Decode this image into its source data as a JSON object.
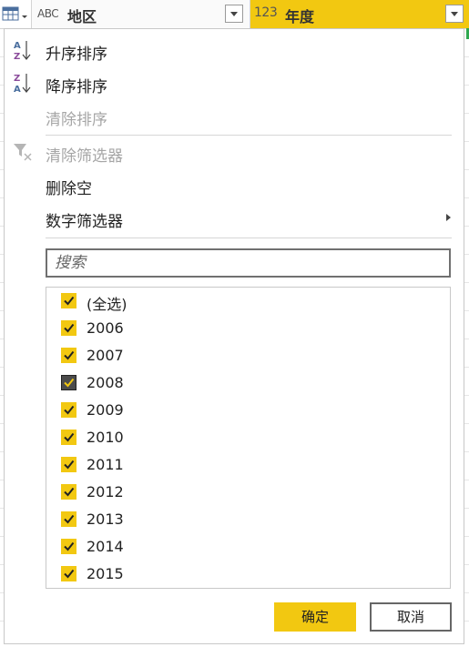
{
  "header": {
    "table_icon": "table-icon",
    "columns": [
      {
        "type_label": "ABC",
        "name": "地区",
        "active": false
      },
      {
        "type_label": "123",
        "name": "年度",
        "active": true
      }
    ]
  },
  "menu": {
    "sort_asc": "升序排序",
    "sort_desc": "降序排序",
    "clear_sort": "清除排序",
    "clear_filter": "清除筛选器",
    "remove_empty": "删除空",
    "number_filters": "数字筛选器"
  },
  "search": {
    "placeholder": "搜索",
    "value": ""
  },
  "list": {
    "items": [
      {
        "label": "(全选)",
        "checked": true
      },
      {
        "label": "2006",
        "checked": true
      },
      {
        "label": "2007",
        "checked": true
      },
      {
        "label": "2008",
        "checked": true,
        "focused": true
      },
      {
        "label": "2009",
        "checked": true
      },
      {
        "label": "2010",
        "checked": true
      },
      {
        "label": "2011",
        "checked": true
      },
      {
        "label": "2012",
        "checked": true
      },
      {
        "label": "2013",
        "checked": true
      },
      {
        "label": "2014",
        "checked": true
      },
      {
        "label": "2015",
        "checked": true
      }
    ]
  },
  "buttons": {
    "ok": "确定",
    "cancel": "取消"
  },
  "colors": {
    "accent": "#f2c811",
    "disabled_text": "#a6a6a6",
    "status_green": "#2fa84f"
  }
}
